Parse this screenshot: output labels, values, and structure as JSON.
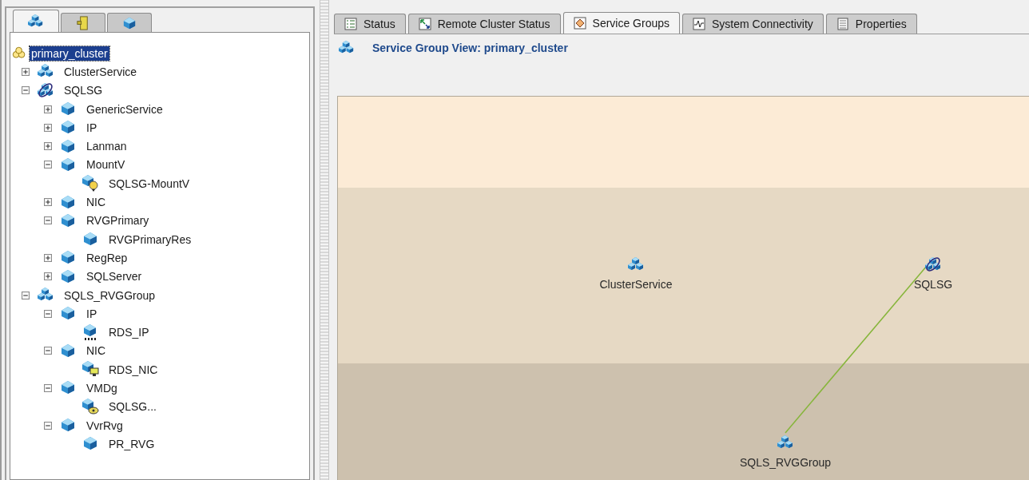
{
  "left_tabs": [
    {
      "selected": true
    },
    {
      "selected": false
    },
    {
      "selected": false
    }
  ],
  "tree": [
    {
      "label": "primary_cluster",
      "kind": "cluster",
      "selected": true,
      "children": [
        {
          "label": "ClusterService",
          "kind": "group",
          "selected": false,
          "expanded": false
        },
        {
          "label": "SQLSG",
          "kind": "global-group",
          "selected": false,
          "expanded": true,
          "children": [
            {
              "label": "GenericService",
              "kind": "resource-type",
              "selected": false,
              "expanded": false
            },
            {
              "label": "IP",
              "kind": "resource-type",
              "selected": false,
              "expanded": false
            },
            {
              "label": "Lanman",
              "kind": "resource-type",
              "selected": false,
              "expanded": false
            },
            {
              "label": "MountV",
              "kind": "resource-type",
              "selected": false,
              "expanded": true,
              "children": [
                {
                  "label": "SQLSG-MountV",
                  "kind": "mount-resource",
                  "selected": false
                }
              ]
            },
            {
              "label": "NIC",
              "kind": "resource-type",
              "selected": false,
              "expanded": false
            },
            {
              "label": "RVGPrimary",
              "kind": "resource-type",
              "selected": false,
              "expanded": true,
              "children": [
                {
                  "label": "RVGPrimaryRes",
                  "kind": "resource",
                  "selected": false
                }
              ]
            },
            {
              "label": "RegRep",
              "kind": "resource-type",
              "selected": false,
              "expanded": false
            },
            {
              "label": "SQLServer",
              "kind": "resource-type",
              "selected": false,
              "expanded": false
            }
          ]
        },
        {
          "label": "SQLS_RVGGroup",
          "kind": "group",
          "selected": false,
          "expanded": true,
          "children": [
            {
              "label": "IP",
              "kind": "resource-type",
              "selected": false,
              "expanded": true,
              "children": [
                {
                  "label": "RDS_IP",
                  "kind": "ip-resource",
                  "selected": false
                }
              ]
            },
            {
              "label": "NIC",
              "kind": "resource-type",
              "selected": false,
              "expanded": true,
              "children": [
                {
                  "label": "RDS_NIC",
                  "kind": "nic-resource",
                  "selected": false
                }
              ]
            },
            {
              "label": "VMDg",
              "kind": "resource-type",
              "selected": false,
              "expanded": true,
              "children": [
                {
                  "label": "SQLSG...",
                  "kind": "disk-resource",
                  "selected": false
                }
              ]
            },
            {
              "label": "VvrRvg",
              "kind": "resource-type",
              "selected": false,
              "expanded": true,
              "children": [
                {
                  "label": "PR_RVG",
                  "kind": "resource",
                  "selected": false
                }
              ]
            }
          ]
        }
      ]
    }
  ],
  "tabs": [
    {
      "label": "Status",
      "selected": false
    },
    {
      "label": "Remote Cluster Status",
      "selected": false
    },
    {
      "label": "Service Groups",
      "selected": true
    },
    {
      "label": "System Connectivity",
      "selected": false
    },
    {
      "label": "Properties",
      "selected": false
    }
  ],
  "view_title": "Service Group View: primary_cluster",
  "graph": {
    "nodes": [
      {
        "label": "ClusterService",
        "kind": "group",
        "linked": false
      },
      {
        "label": "SQLSG",
        "kind": "global-group",
        "linked": true
      },
      {
        "label": "SQLS_RVGGroup",
        "kind": "group",
        "linked": true
      }
    ]
  }
}
